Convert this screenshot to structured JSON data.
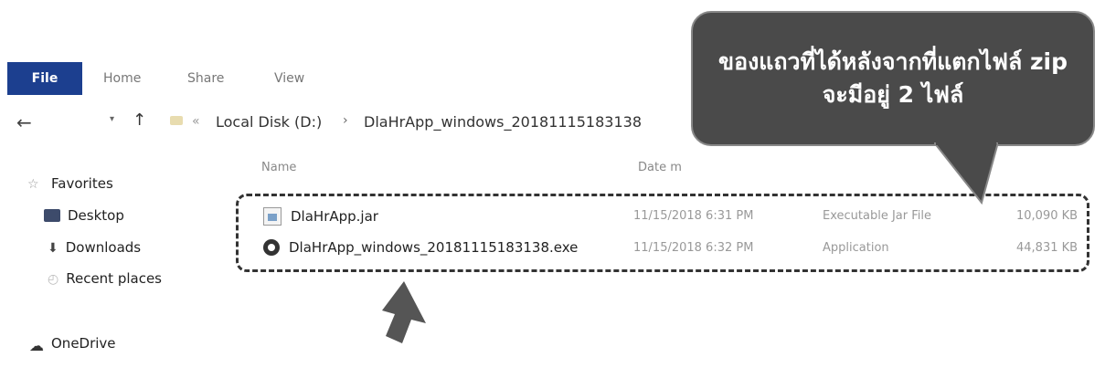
{
  "ribbon": {
    "tabs": [
      "File",
      "Home",
      "Share",
      "View"
    ]
  },
  "address": {
    "back_icon": "←",
    "dropdown_icon": "▾",
    "up_icon": "↑",
    "crumb_prefix": "«",
    "crumbs": [
      "Local Disk (D:)",
      "DlaHrApp_windows_20181115183138"
    ],
    "separator": "›"
  },
  "columns": {
    "name": "Name",
    "date": "Date m"
  },
  "nav": {
    "favorites": "Favorites",
    "desktop": "Desktop",
    "downloads": "Downloads",
    "recent": "Recent places",
    "onedrive": "OneDrive"
  },
  "files": [
    {
      "name": "DlaHrApp.jar",
      "date": "11/15/2018 6:31 PM",
      "type": "Executable Jar File",
      "size": "10,090 KB",
      "icon": "jar-file-icon"
    },
    {
      "name": "DlaHrApp_windows_20181115183138.exe",
      "date": "11/15/2018 6:32 PM",
      "type": "Application",
      "size": "44,831 KB",
      "icon": "exe-app-icon"
    }
  ],
  "callout": {
    "line1": "ของแถวที่ได้หลังจากที่แตกไฟล์ zip",
    "line2": "จะมีอยู่ 2 ไฟล์"
  },
  "colors": {
    "file_tab": "#1c3f8f",
    "callout_bg": "#4a4a4a",
    "arrow": "#555555"
  }
}
